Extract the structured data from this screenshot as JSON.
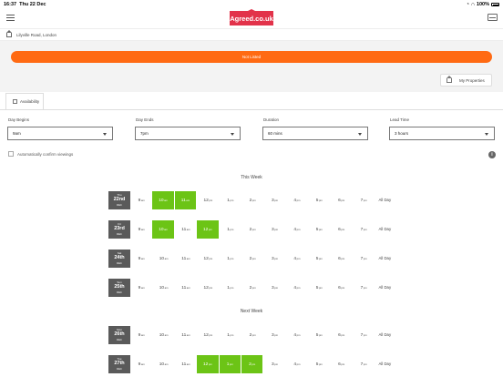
{
  "status_bar": {
    "time": "16:37",
    "date": "Thu 22 Dec",
    "battery": "100%"
  },
  "header": {
    "logo": "Agreed.co.uk"
  },
  "breadcrumb": {
    "address": "Lilyville Road, London"
  },
  "listing": {
    "status_button": "Not Listed",
    "my_properties": "My Properties"
  },
  "tabs": [
    {
      "label": "Availability"
    }
  ],
  "fields": {
    "day_begins": {
      "label": "Day Begins",
      "value": "9am"
    },
    "day_ends": {
      "label": "Day Ends",
      "value": "7pm"
    },
    "duration": {
      "label": "Duration",
      "value": "60 mins"
    },
    "lead_time": {
      "label": "Lead Time",
      "value": "3 hours"
    }
  },
  "auto_confirm": {
    "label": "Automatically confirm viewings",
    "checked": false
  },
  "info_icon": "i",
  "colors": {
    "brand": "#e2324a",
    "orange": "#ff6a13",
    "selected": "#6cc416",
    "day_bg": "#5a5a5a"
  },
  "slot_hours": [
    {
      "h": "9",
      "ap": "am"
    },
    {
      "h": "10",
      "ap": "am"
    },
    {
      "h": "11",
      "ap": "am"
    },
    {
      "h": "12",
      "ap": "pm"
    },
    {
      "h": "1",
      "ap": "pm"
    },
    {
      "h": "2",
      "ap": "pm"
    },
    {
      "h": "3",
      "ap": "pm"
    },
    {
      "h": "4",
      "ap": "pm"
    },
    {
      "h": "5",
      "ap": "pm"
    },
    {
      "h": "6",
      "ap": "pm"
    },
    {
      "h": "7",
      "ap": "pm"
    }
  ],
  "all_day_label": "All Day",
  "weeks": [
    {
      "title": "This Week",
      "days": [
        {
          "dow": "Thu",
          "num": "22nd",
          "mon": "DEC",
          "selected": [
            "10am",
            "11am"
          ]
        },
        {
          "dow": "Fri",
          "num": "23rd",
          "mon": "DEC",
          "selected": [
            "10am",
            "12pm"
          ]
        },
        {
          "dow": "Sat",
          "num": "24th",
          "mon": "DEC",
          "selected": []
        },
        {
          "dow": "Sun",
          "num": "25th",
          "mon": "DEC",
          "selected": []
        }
      ]
    },
    {
      "title": "Next Week",
      "days": [
        {
          "dow": "Mon",
          "num": "26th",
          "mon": "DEC",
          "selected": []
        },
        {
          "dow": "Tue",
          "num": "27th",
          "mon": "DEC",
          "selected": [
            "12pm",
            "1pm",
            "2pm"
          ]
        }
      ]
    }
  ]
}
